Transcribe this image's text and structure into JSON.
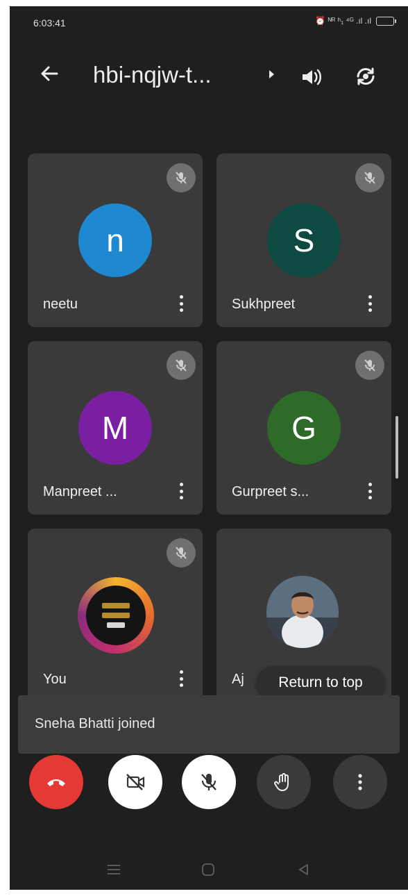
{
  "status_bar": {
    "time": "6:03:41",
    "indicators": "⏰ ᴺᴿ ʰ₁ ⁴ᴳ .ıl .ıl"
  },
  "header": {
    "title": "hbi-nqjw-t...",
    "back_icon": "arrow-left-icon",
    "speaker_icon": "speaker-icon",
    "flip_icon": "camera-flip-icon"
  },
  "participants": [
    {
      "name": "neetu",
      "initial": "n",
      "color": "#1e88d0",
      "muted": true
    },
    {
      "name": "Sukhpreet",
      "initial": "S",
      "color": "#0d4a41",
      "muted": true
    },
    {
      "name": "Manpreet ...",
      "initial": "M",
      "color": "#7b1fa2",
      "muted": true
    },
    {
      "name": "Gurpreet s...",
      "initial": "G",
      "color": "#2e6b28",
      "muted": true
    },
    {
      "name": "You",
      "initial": "",
      "muted": true
    },
    {
      "name": "Aj",
      "initial": "",
      "muted": false
    }
  ],
  "return_to_top": "Return to top",
  "toast": "Sneha Bhatti joined",
  "controls": {
    "end_call_color": "#e53935",
    "items": [
      "end-call-icon",
      "camera-off-icon",
      "mic-off-icon",
      "raise-hand-icon",
      "more-options-icon"
    ]
  },
  "nav_bar": [
    "menu-icon",
    "home-icon",
    "back-triangle-icon"
  ]
}
